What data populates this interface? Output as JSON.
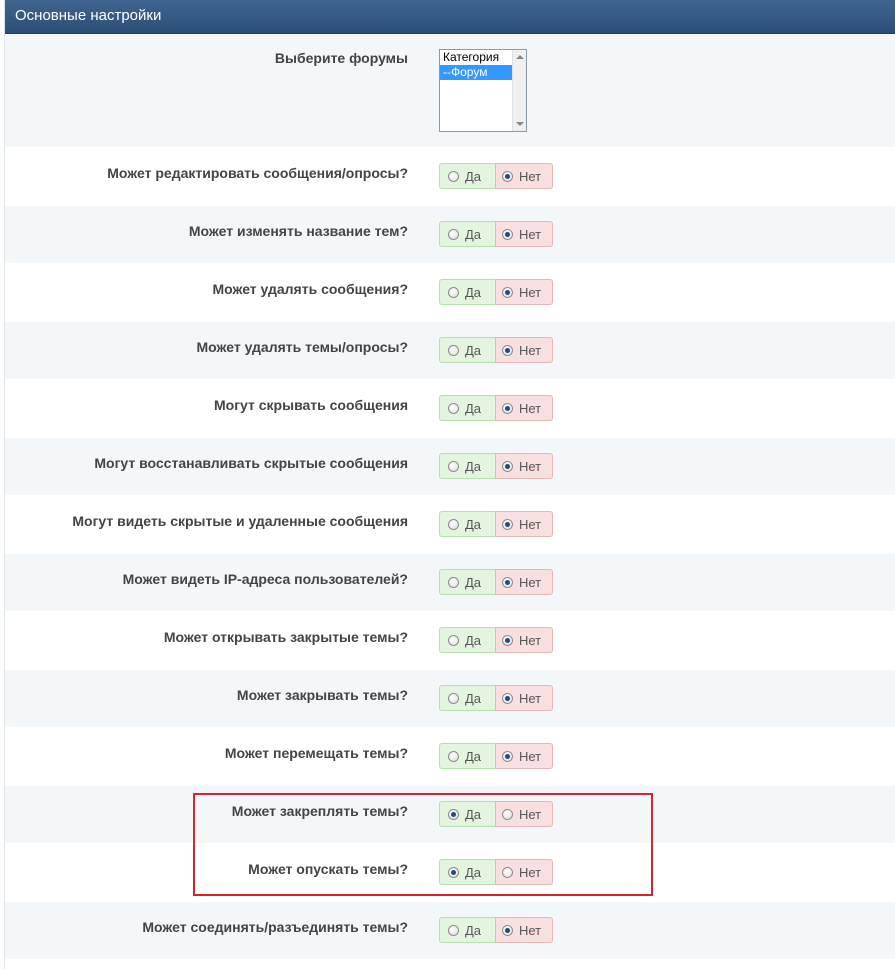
{
  "panel": {
    "title": "Основные настройки"
  },
  "forum_select": {
    "label": "Выберите форумы",
    "options": [
      "Категория",
      "--Форум"
    ],
    "selected": "--Форум"
  },
  "options_yes_label": "Да",
  "options_no_label": "Нет",
  "permissions": [
    {
      "label": "Может редактировать сообщения/опросы?",
      "value": "Нет"
    },
    {
      "label": "Может изменять название тем?",
      "value": "Нет"
    },
    {
      "label": "Может удалять сообщения?",
      "value": "Нет"
    },
    {
      "label": "Может удалять темы/опросы?",
      "value": "Нет"
    },
    {
      "label": "Могут скрывать сообщения",
      "value": "Нет"
    },
    {
      "label": "Могут восстанавливать скрытые сообщения",
      "value": "Нет"
    },
    {
      "label": "Могут видеть скрытые и удаленные сообщения",
      "value": "Нет"
    },
    {
      "label": "Может видеть IP-адреса пользователей?",
      "value": "Нет"
    },
    {
      "label": "Может открывать закрытые темы?",
      "value": "Нет"
    },
    {
      "label": "Может закрывать темы?",
      "value": "Нет"
    },
    {
      "label": "Может перемещать темы?",
      "value": "Нет"
    },
    {
      "label": "Может закреплять темы?",
      "value": "Да"
    },
    {
      "label": "Может опускать темы?",
      "value": "Да"
    },
    {
      "label": "Может соединять/разъединять темы?",
      "value": "Нет"
    }
  ],
  "colors": {
    "header_bg": "#2f5580",
    "highlight_border": "#e0202a",
    "yes_bg": "#e3f4df",
    "no_bg": "#f9e0e0"
  }
}
